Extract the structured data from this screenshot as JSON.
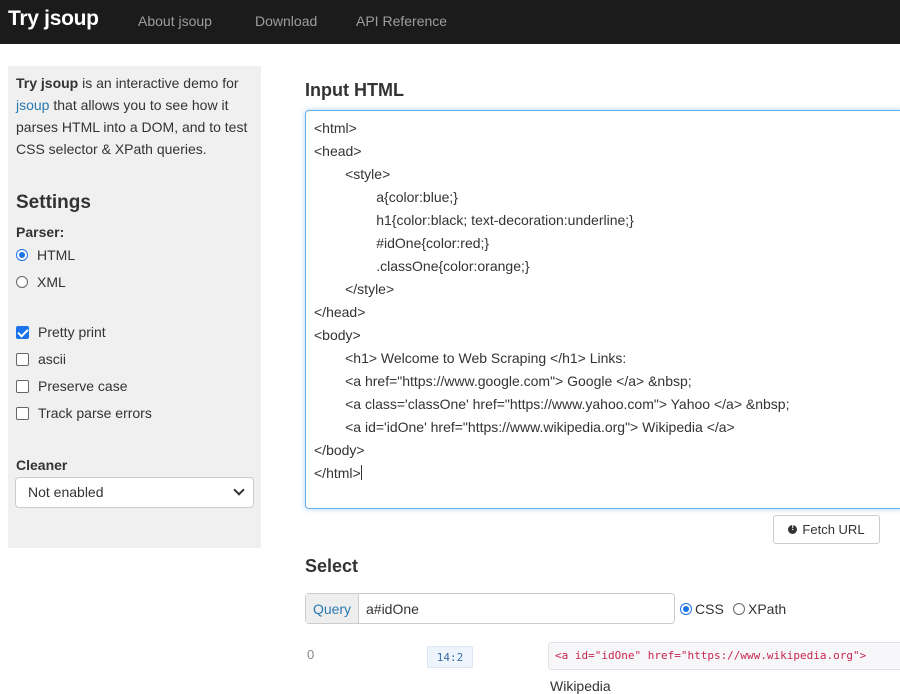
{
  "navbar": {
    "brand": "Try jsoup",
    "links": [
      "About jsoup",
      "Download",
      "API Reference"
    ]
  },
  "sidebar": {
    "intro": {
      "bold": "Try jsoup",
      "pre_link": " is an interactive demo for ",
      "link": "jsoup",
      "post_link": " that allows you to see how it parses HTML into a DOM, and to test CSS selector & XPath queries."
    },
    "settings_title": "Settings",
    "parser_label": "Parser:",
    "parsers": [
      {
        "label": "HTML",
        "checked": true
      },
      {
        "label": "XML",
        "checked": false
      }
    ],
    "options": [
      {
        "label": "Pretty print",
        "checked": true
      },
      {
        "label": "ascii",
        "checked": false
      },
      {
        "label": "Preserve case",
        "checked": false
      },
      {
        "label": "Track parse errors",
        "checked": false
      }
    ],
    "cleaner_label": "Cleaner",
    "cleaner_value": "Not enabled"
  },
  "input": {
    "title": "Input HTML",
    "lines": [
      "<html>",
      "<head>",
      "        <style>",
      "                a{color:blue;}",
      "                h1{color:black; text-decoration:underline;}",
      "                #idOne{color:red;}",
      "                .classOne{color:orange;}",
      "        </style>",
      "</head>",
      "<body>",
      "        <h1> Welcome to Web Scraping </h1> Links:",
      "        <a href=\"https://www.google.com\"> Google </a> &nbsp;",
      "        <a class='classOne' href=\"https://www.yahoo.com\"> Yahoo </a> &nbsp;",
      "        <a id='idOne' href=\"https://www.wikipedia.org\"> Wikipedia </a>",
      "</body>",
      "</html>"
    ],
    "fetch_label": "Fetch URL"
  },
  "select": {
    "title": "Select",
    "query_addon": "Query",
    "query_value": "a#idOne",
    "modes": [
      {
        "label": "CSS",
        "checked": true
      },
      {
        "label": "XPath",
        "checked": false
      }
    ]
  },
  "result": {
    "index": "0",
    "position": "14:2",
    "html": "<a id=\"idOne\" href=\"https://www.wikipedia.org\">",
    "text": "Wikipedia"
  },
  "colors": {
    "navbar_bg": "#1b1b1b",
    "link": "#2a7ab0",
    "accent": "#1a73e8",
    "code_red": "#c7254e"
  }
}
